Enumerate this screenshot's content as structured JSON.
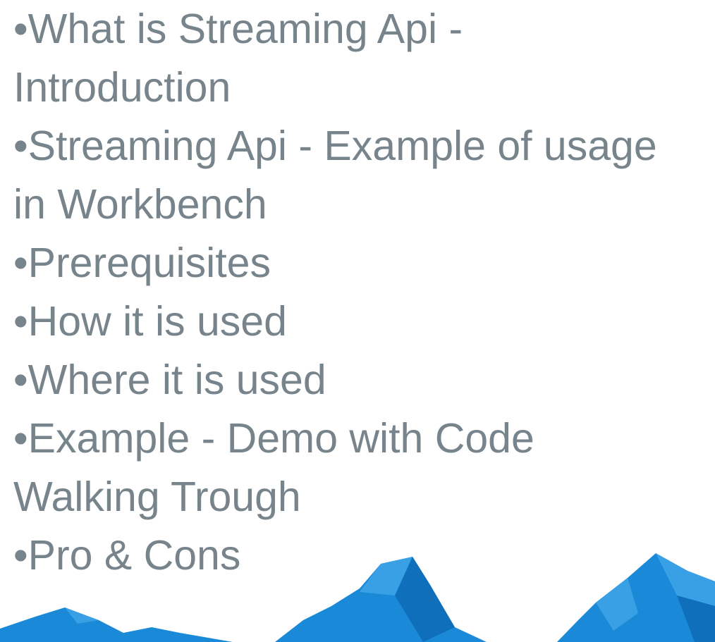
{
  "agenda": {
    "items": [
      {
        "lines": [
          "•What is Streaming Api -",
          "Introduction"
        ]
      },
      {
        "lines": [
          "•Streaming Api - Example of usage",
          "in Workbench"
        ]
      },
      {
        "lines": [
          "•Prerequisites"
        ]
      },
      {
        "lines": [
          "•How it is used"
        ]
      },
      {
        "lines": [
          "•Where it is used"
        ]
      },
      {
        "lines": [
          "•Example - Demo with Code",
          "Walking Trough"
        ]
      },
      {
        "lines": [
          "•Pro & Cons"
        ]
      }
    ]
  },
  "colors": {
    "text": "#78848c",
    "mountain_primary": "#1a8ad8",
    "mountain_light": "#3aa0e6",
    "mountain_dark": "#0f6fba"
  }
}
